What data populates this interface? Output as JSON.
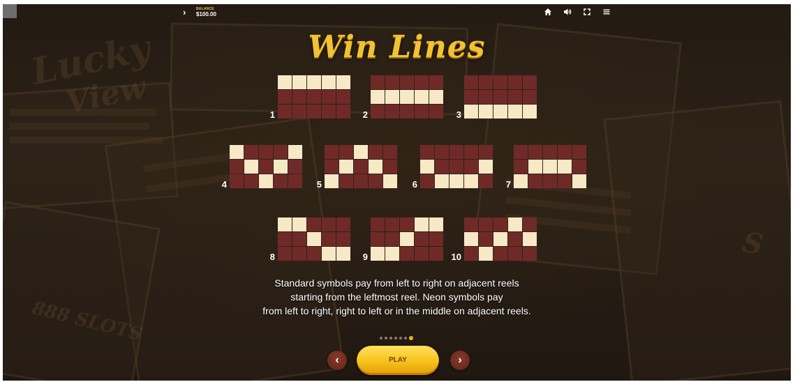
{
  "header": {
    "balance_label": "BALANCE",
    "balance_value": "$100.00"
  },
  "title": "Win Lines",
  "paylines": [
    {
      "number": "1",
      "rows": [
        1,
        1,
        1,
        1,
        1
      ]
    },
    {
      "number": "2",
      "rows": [
        2,
        2,
        2,
        2,
        2
      ]
    },
    {
      "number": "3",
      "rows": [
        3,
        3,
        3,
        3,
        3
      ]
    },
    {
      "number": "4",
      "rows": [
        1,
        2,
        3,
        2,
        1
      ]
    },
    {
      "number": "5",
      "rows": [
        3,
        2,
        1,
        2,
        3
      ]
    },
    {
      "number": "6",
      "rows": [
        2,
        3,
        3,
        3,
        2
      ]
    },
    {
      "number": "7",
      "rows": [
        3,
        2,
        2,
        2,
        3
      ]
    },
    {
      "number": "8",
      "rows": [
        1,
        1,
        2,
        3,
        3
      ]
    },
    {
      "number": "9",
      "rows": [
        3,
        3,
        2,
        1,
        1
      ]
    },
    {
      "number": "10",
      "rows": [
        2,
        3,
        2,
        1,
        2
      ]
    }
  ],
  "description": {
    "line1": "Standard symbols pay from left to right on adjacent reels",
    "line2": "starting from the leftmost reel. Neon symbols pay",
    "line3": "from left to right, right to left or in the middle on adjacent reels."
  },
  "pager": {
    "pages": 7,
    "active_page": 7
  },
  "buttons": {
    "prev_symbol": "‹",
    "play_label": "PLAY",
    "next_symbol": "›"
  },
  "colors": {
    "cell_on": "#f7e8c6",
    "cell_off": "#6f2a28",
    "title_gold": "#f2c230",
    "play_yellow": "#f7c21a"
  },
  "icons": [
    "menu-chevron-icon",
    "home-icon",
    "sound-icon",
    "fullscreen-icon",
    "hamburger-menu-icon"
  ]
}
